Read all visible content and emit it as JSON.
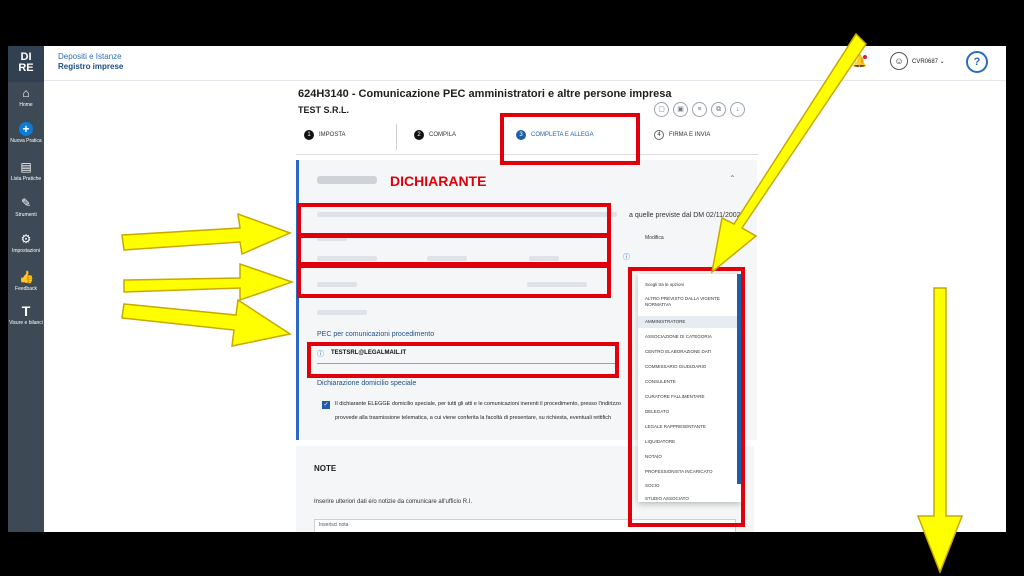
{
  "sidebar": {
    "logo_top": "DI",
    "logo_bottom": "RE",
    "items": [
      {
        "label": "Home",
        "icon": "home-icon",
        "glyph": "⌂"
      },
      {
        "label": "Nuova Pratica",
        "icon": "plus-icon",
        "glyph": "+"
      },
      {
        "label": "Lista Pratiche",
        "icon": "document-list-icon",
        "glyph": "▤"
      },
      {
        "label": "Strumenti",
        "icon": "wrench-icon",
        "glyph": "✎"
      },
      {
        "label": "Impostazioni",
        "icon": "gear-icon",
        "glyph": "⚙"
      },
      {
        "label": "Feedback",
        "icon": "thumbs-up-icon",
        "glyph": "👍"
      },
      {
        "label": "Visure e bilanci",
        "icon": "text-icon",
        "glyph": "T"
      }
    ]
  },
  "header": {
    "line1": "Depositi e Istanze",
    "line2": "Registro imprese",
    "user": "CVR0687 ⌄",
    "help": "?"
  },
  "page": {
    "title": "624H3140 - Comunicazione PEC amministratori e altre persone impresa",
    "company": "TEST S.R.L."
  },
  "steps": [
    {
      "num": "1",
      "label": "IMPOSTA"
    },
    {
      "num": "2",
      "label": "COMPILA"
    },
    {
      "num": "3",
      "label": "COMPLETA E ALLEGA"
    },
    {
      "num": "4",
      "label": "FIRMA E INVIA"
    }
  ],
  "form": {
    "decl_text": "a quelle previste dal DM 02/11/2002",
    "select_label": "Modifica",
    "pec_label": "PEC per comunicazioni procedimento",
    "pec_value": "TESTSRL@LEGALMAIL.IT",
    "domicile_label": "Dichiarazione domicilio speciale",
    "domicile_text1": "Il dichiarante ELEGGE domicilio speciale, per tutti gli atti e le comunicazioni inerenti il procedimento, presso l'indirizzo",
    "domicile_text2": "provvede alla trasmissione telematica, a cui viene conferita la facoltà di presentare, su richiesta, eventuali rettifich"
  },
  "note": {
    "title": "NOTE",
    "text": "Inserire ulteriori dati e/o notizie da comunicare all'ufficio R.I.",
    "placeholder": "Inserisci nota"
  },
  "dropdown": {
    "options": [
      "Scegli tra le opzioni",
      "ALTRO PREVISTO DALLA VIGENTE NORMATIVA",
      "AMMINISTRATORE",
      "ASSOCIAZIONE DI CATEGORIA",
      "CENTRO ELABORAZIONE DATI",
      "COMMISSARIO GIUDIZIARIO",
      "CONSULENTE",
      "CURATORE FALLIMENTARE",
      "DELEGATO",
      "LEGALE RAPPRESENTANTE",
      "LIQUIDATORE",
      "NOTAIO",
      "PROFESSIONISTA INCARICATO",
      "SOCIO",
      "STUDIO ASSOCIATO"
    ],
    "highlighted": "AMMINISTRATORE"
  },
  "annotation": {
    "label": "DICHIARANTE",
    "color": "#e0000b",
    "arrow_color": "#ffff00"
  }
}
